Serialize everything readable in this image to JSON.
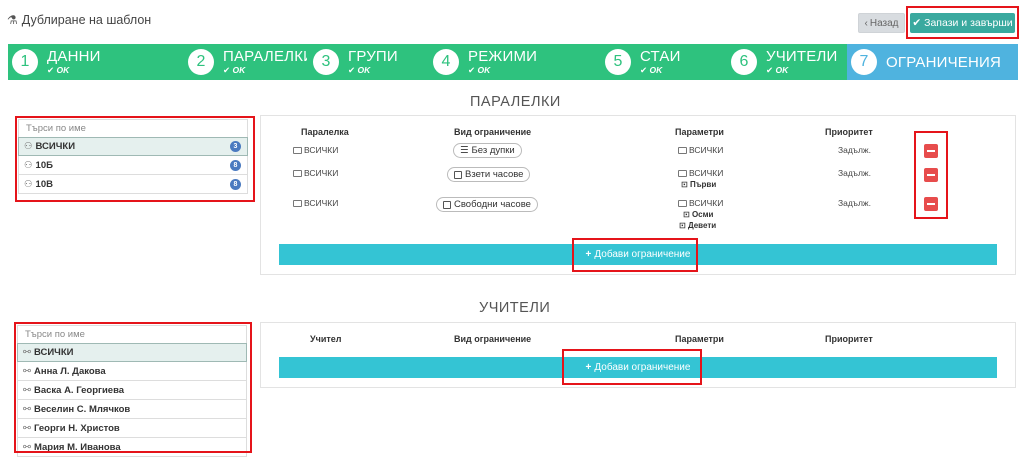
{
  "header": {
    "title": "Дублиране на шаблон",
    "back_label": "Назад",
    "save_label": "Запази и завърши"
  },
  "wizard": {
    "steps": [
      {
        "num": "1",
        "name": "ДАННИ",
        "status": "OK"
      },
      {
        "num": "2",
        "name": "ПАРАЛЕЛКИ",
        "status": "OK"
      },
      {
        "num": "3",
        "name": "ГРУПИ",
        "status": "OK"
      },
      {
        "num": "4",
        "name": "РЕЖИМИ",
        "status": "OK"
      },
      {
        "num": "5",
        "name": "СТАИ",
        "status": "OK"
      },
      {
        "num": "6",
        "name": "УЧИТЕЛИ",
        "status": "OK"
      },
      {
        "num": "7",
        "name": "ОГРАНИЧЕНИЯ",
        "status": ""
      }
    ]
  },
  "classes_section": {
    "title": "ПАРАЛЕЛКИ",
    "search_placeholder": "Търси по име",
    "items": [
      {
        "label": "ВСИЧКИ",
        "count": "3"
      },
      {
        "label": "10Б",
        "count": "8"
      },
      {
        "label": "10В",
        "count": "8"
      }
    ],
    "headers": {
      "entity": "Паралелка",
      "type": "Вид ограничение",
      "params": "Параметри",
      "priority": "Приоритет"
    },
    "rows": [
      {
        "entity": "ВСИЧКИ",
        "type": "Без дупки",
        "param": "ВСИЧКИ",
        "sub": [],
        "priority": "Задълж."
      },
      {
        "entity": "ВСИЧКИ",
        "type": "Взети часове",
        "param": "ВСИЧКИ",
        "sub": [
          "Първи"
        ],
        "priority": "Задълж."
      },
      {
        "entity": "ВСИЧКИ",
        "type": "Свободни часове",
        "param": "ВСИЧКИ",
        "sub": [
          "Осми",
          "Девети"
        ],
        "priority": "Задълж."
      }
    ],
    "add_label": "Добави ограничение"
  },
  "teachers_section": {
    "title": "УЧИТЕЛИ",
    "search_placeholder": "Търси по име",
    "items": [
      {
        "label": "ВСИЧКИ"
      },
      {
        "label": "Анна Л. Дакова"
      },
      {
        "label": "Васка А. Георгиева"
      },
      {
        "label": "Веселин С. Млячков"
      },
      {
        "label": "Георги Н. Христов"
      },
      {
        "label": "Мария М. Иванова"
      }
    ],
    "headers": {
      "entity": "Учител",
      "type": "Вид ограничение",
      "params": "Параметри",
      "priority": "Приоритет"
    },
    "add_label": "Добави ограничение"
  },
  "colors": {
    "green": "#2ec27e",
    "blue": "#4fb3df",
    "teal": "#34c4d4",
    "save": "#3aa99f",
    "remove": "#e74c4c",
    "highlight": "#e5141a"
  }
}
